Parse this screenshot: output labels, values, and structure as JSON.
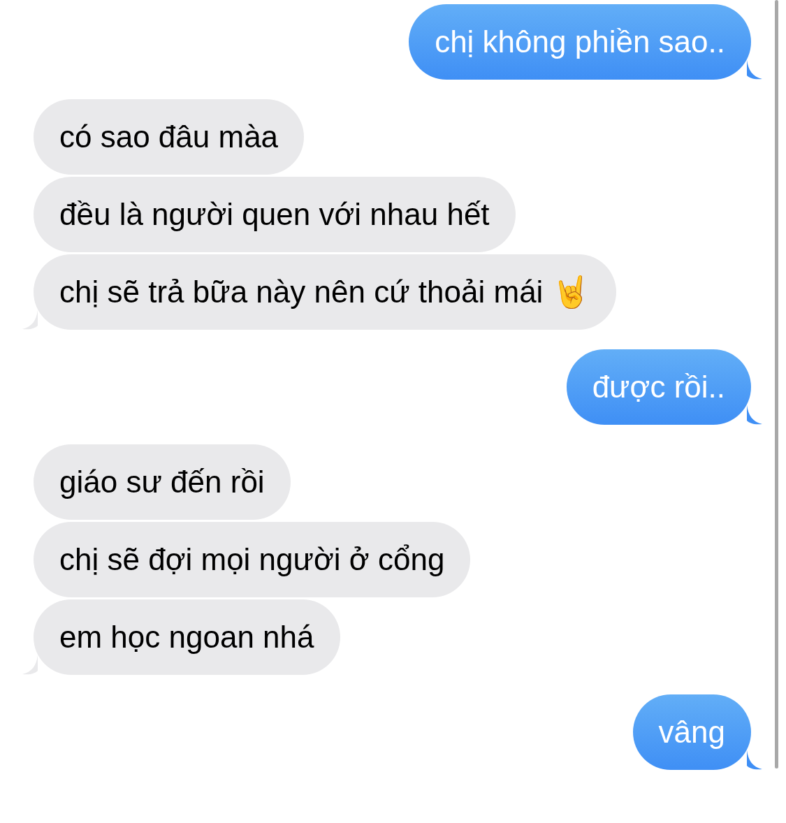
{
  "messages": [
    {
      "kind": "sent",
      "text": "chị không phiền sao..",
      "tail": true
    },
    {
      "kind": "received",
      "text": "có sao đâu màa",
      "tail": false
    },
    {
      "kind": "received",
      "text": "đều là người quen với nhau hết",
      "tail": false
    },
    {
      "kind": "received",
      "text": "chị sẽ trả bữa này nên cứ thoải mái 🤘",
      "tail": true
    },
    {
      "kind": "sent",
      "text": "được rồi..",
      "tail": true
    },
    {
      "kind": "received",
      "text": "giáo sư đến rồi",
      "tail": false
    },
    {
      "kind": "received",
      "text": "chị sẽ đợi mọi người ở cổng",
      "tail": false
    },
    {
      "kind": "received",
      "text": "em học ngoan nhá",
      "tail": true
    },
    {
      "kind": "sent",
      "text": "vâng",
      "tail": true
    }
  ]
}
